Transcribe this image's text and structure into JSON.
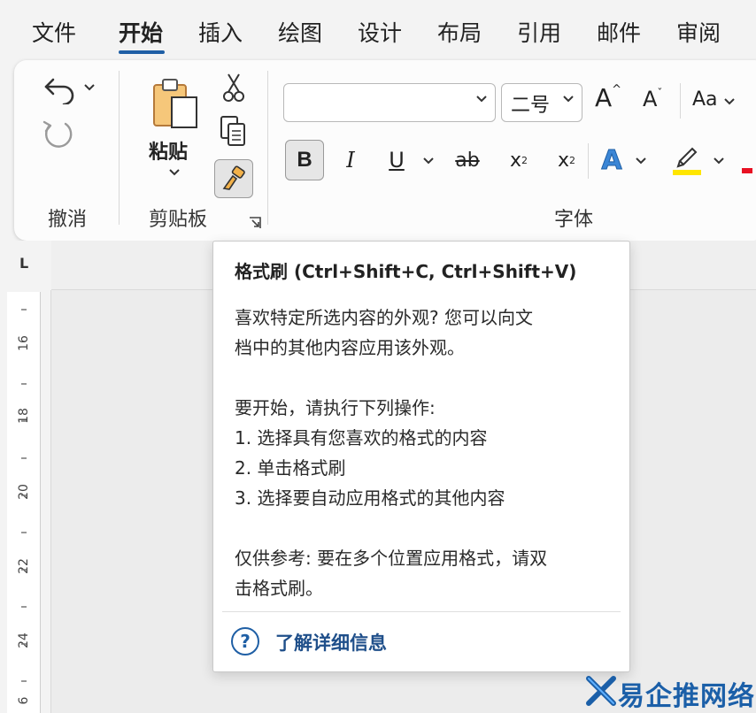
{
  "tabs": [
    {
      "label": "文件",
      "active": false
    },
    {
      "label": "开始",
      "active": true
    },
    {
      "label": "插入",
      "active": false
    },
    {
      "label": "绘图",
      "active": false
    },
    {
      "label": "设计",
      "active": false
    },
    {
      "label": "布局",
      "active": false
    },
    {
      "label": "引用",
      "active": false
    },
    {
      "label": "邮件",
      "active": false
    },
    {
      "label": "审阅",
      "active": false
    }
  ],
  "ribbon": {
    "undo_group_label": "撤消",
    "clipboard_group_label": "剪贴板",
    "paste_label": "粘贴",
    "font_group_label": "字体",
    "font_name_value": "",
    "font_size_value": "二号",
    "change_case_label": "Aa",
    "bold_label": "B",
    "italic_label": "I",
    "underline_label": "U",
    "strike_label": "ab",
    "subscript_label": "x",
    "subscript_mark": "2",
    "superscript_label": "x",
    "superscript_mark": "2",
    "text_effect_label": "A",
    "grow_font_label": "A",
    "shrink_font_label": "A",
    "highlight_color": "#ffe600",
    "font_color": "#e81123"
  },
  "ruler": {
    "corner_mark": "L",
    "numbers": [
      "16",
      "18",
      "20",
      "22",
      "24",
      "6"
    ]
  },
  "tooltip": {
    "title": "格式刷 (Ctrl+Shift+C, Ctrl+Shift+V)",
    "line1": "喜欢特定所选内容的外观? 您可以向文",
    "line2": "档中的其他内容应用该外观。",
    "line3": "要开始，请执行下列操作:",
    "line4": "1. 选择具有您喜欢的格式的内容",
    "line5": "2. 单击格式刷",
    "line6": "3. 选择要自动应用格式的其他内容",
    "line7": "仅供参考: 要在多个位置应用格式，请双",
    "line8": "击格式刷。",
    "link_icon": "?",
    "link_label": "了解详细信息"
  },
  "watermark": {
    "text": "易企推网络"
  },
  "colors": {
    "accent": "#1f5fa5",
    "link": "#1f4f8a",
    "watermark": "#1b5fa8"
  }
}
